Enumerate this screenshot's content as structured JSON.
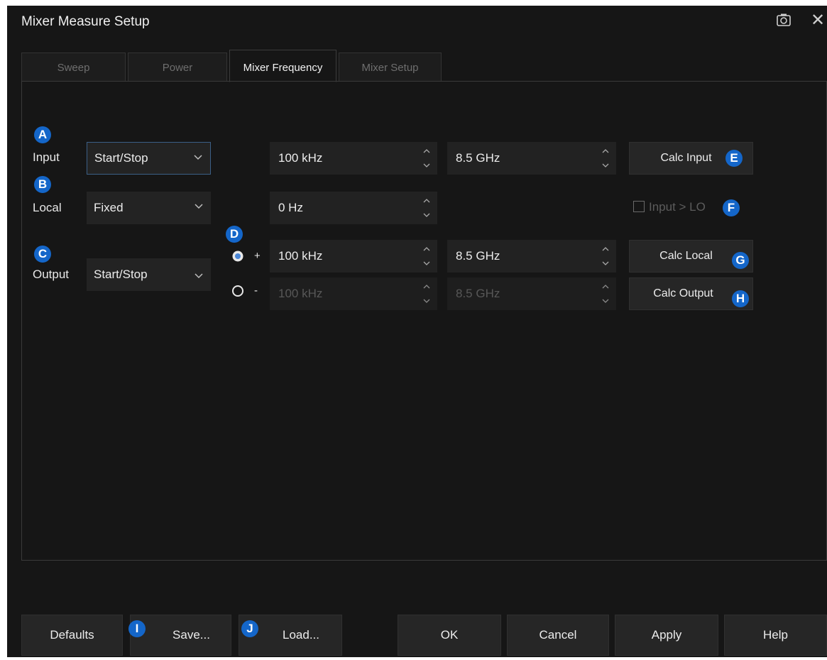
{
  "window": {
    "title": "Mixer Measure Setup"
  },
  "tabs": [
    {
      "label": "Sweep",
      "active": false
    },
    {
      "label": "Power",
      "active": false
    },
    {
      "label": "Mixer Frequency",
      "active": true
    },
    {
      "label": "Mixer Setup",
      "active": false
    }
  ],
  "rows": {
    "input": {
      "label": "Input",
      "mode": "Start/Stop",
      "start": "100 kHz",
      "stop": "8.5 GHz",
      "button": "Calc Input"
    },
    "local": {
      "label": "Local",
      "mode": "Fixed",
      "value": "0 Hz",
      "checkbox": "Input > LO",
      "checked": false
    },
    "output": {
      "label": "Output",
      "mode": "Start/Stop",
      "plus": {
        "sign": "+",
        "start": "100 kHz",
        "stop": "8.5 GHz",
        "selected": true,
        "button": "Calc Local"
      },
      "minus": {
        "sign": "-",
        "start": "100 kHz",
        "stop": "8.5 GHz",
        "selected": false,
        "button": "Calc Output"
      }
    }
  },
  "markers": {
    "a": "A",
    "b": "B",
    "c": "C",
    "d": "D",
    "e": "E",
    "f": "F",
    "g": "G",
    "h": "H",
    "i": "I",
    "j": "J"
  },
  "footer": {
    "defaults": "Defaults",
    "save": "Save...",
    "load": "Load...",
    "ok": "OK",
    "cancel": "Cancel",
    "apply": "Apply",
    "help": "Help"
  },
  "icons": {
    "camera": "camera-icon",
    "close": "close-icon",
    "chevron": "chevron-down-icon",
    "spinner": "spinner-icon"
  },
  "colors": {
    "accent": "#1466c9",
    "background": "#161616",
    "field": "#222222"
  }
}
